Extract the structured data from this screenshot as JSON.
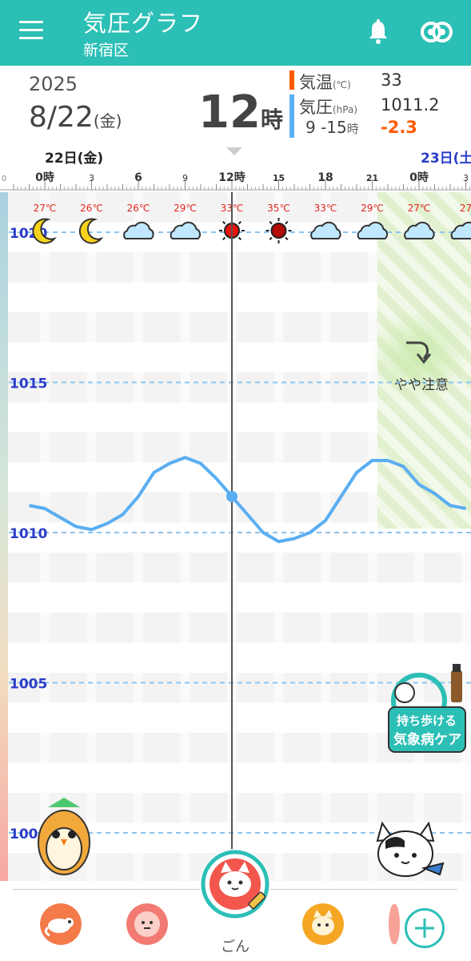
{
  "appbar": {
    "title": "気圧グラフ",
    "location": "新宿区"
  },
  "info": {
    "year": "2025",
    "date": "8/22",
    "dow": "(金)",
    "hour": "12",
    "hour_suffix": "時",
    "temp_label": "気温",
    "temp_unit": "(℃)",
    "temp_value": "33",
    "pressure_label": "気圧",
    "pressure_unit": "(hPa)",
    "pressure_value": "1011.2",
    "range_label": "9 -15",
    "range_suffix": "時",
    "range_delta": "-2.3",
    "colors": {
      "temp": "#ff5a00",
      "pressure": "#5ab0f5",
      "delta": "#ff5a00"
    }
  },
  "timeline": {
    "day1": "22日(金)",
    "day2": "23日(土",
    "hours": [
      "0時",
      "3",
      "6",
      "9",
      "12時",
      "15",
      "18",
      "21",
      "0時",
      "3"
    ],
    "left_edge_temp": "℃"
  },
  "forecast": {
    "temps": [
      "27℃",
      "26℃",
      "26℃",
      "29℃",
      "33℃",
      "35℃",
      "33℃",
      "29℃",
      "27℃",
      "27"
    ],
    "icons": [
      "moon-icon",
      "moon-icon",
      "cloud-icon",
      "cloud-icon",
      "sun-icon",
      "sun-icon",
      "cloud-icon",
      "cloud-icon",
      "cloud-icon",
      "cloud-icon"
    ]
  },
  "chart_data": {
    "type": "line",
    "title": "",
    "ylabel": "",
    "y_ticks": [
      "1020",
      "1015",
      "1010",
      "1005",
      "100"
    ],
    "ylim": [
      1000,
      1020
    ],
    "x": [
      -1,
      0,
      1,
      2,
      3,
      4,
      5,
      6,
      7,
      8,
      9,
      10,
      11,
      12,
      13,
      14,
      15,
      16,
      17,
      18,
      19,
      20,
      21,
      22,
      23,
      24,
      25,
      26,
      27
    ],
    "values": [
      1010.9,
      1010.8,
      1010.5,
      1010.2,
      1010.1,
      1010.3,
      1010.6,
      1011.2,
      1012.0,
      1012.3,
      1012.5,
      1012.3,
      1011.8,
      1011.2,
      1010.6,
      1010.0,
      1009.7,
      1009.8,
      1010.0,
      1010.4,
      1011.2,
      1012.0,
      1012.4,
      1012.4,
      1012.2,
      1011.6,
      1011.3,
      1010.9,
      1010.8
    ],
    "current_x": 12,
    "warning_label": "やや注意",
    "warning_start": 21,
    "promo_label_1": "持ち歩ける",
    "promo_label_2": "気象病ケア",
    "line_color": "#5aaef2",
    "dashed_color": "#8cc4f0"
  },
  "nav": {
    "center_label": "ごん",
    "buttons": [
      "chameleon-icon",
      "face-icon",
      "cat-icon"
    ],
    "accent": "#2cbfb6"
  }
}
